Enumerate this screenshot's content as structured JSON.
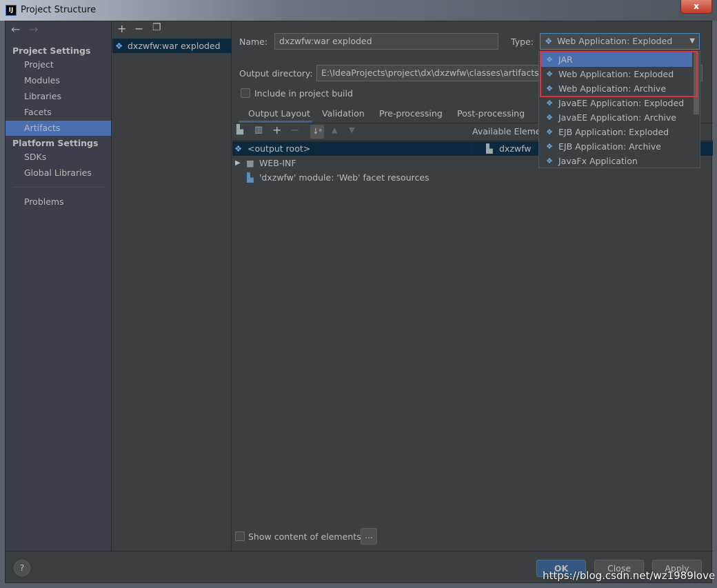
{
  "window": {
    "title": "Project Structure",
    "logo": "IJ",
    "close": "x"
  },
  "sidebar": {
    "project_settings": "Project Settings",
    "items": [
      {
        "label": "Project"
      },
      {
        "label": "Modules"
      },
      {
        "label": "Libraries"
      },
      {
        "label": "Facets"
      },
      {
        "label": "Artifacts",
        "selected": true
      }
    ],
    "platform_settings": "Platform Settings",
    "platform_items": [
      {
        "label": "SDKs"
      },
      {
        "label": "Global Libraries"
      }
    ],
    "problems": "Problems"
  },
  "artifacts": {
    "items": [
      {
        "label": "dxzwfw:war exploded"
      }
    ]
  },
  "form": {
    "name_label": "Name:",
    "name_value": "dxzwfw:war exploded",
    "type_label": "Type:",
    "type_value": "Web Application: Exploded",
    "output_label": "Output directory:",
    "output_value": "E:\\IdeaProjects\\project\\dx\\dxzwfw\\classes\\artifacts\\dx",
    "include_label": "Include in project build",
    "include_checked": false
  },
  "tabs": [
    {
      "label": "Output Layout",
      "active": true
    },
    {
      "label": "Validation"
    },
    {
      "label": "Pre-processing"
    },
    {
      "label": "Post-processing"
    }
  ],
  "layout": {
    "available_label": "Available Elemer",
    "tree": [
      {
        "label": "<output root>",
        "selected": true
      },
      {
        "label": "WEB-INF"
      },
      {
        "label": "'dxzwfw' module: 'Web' facet resources"
      }
    ],
    "available": [
      {
        "label": "dxzwfw"
      }
    ],
    "show_content_label": "Show content of elements",
    "more_button": "..."
  },
  "dropdown": {
    "options": [
      {
        "label": "JAR",
        "selected": true
      },
      {
        "label": "Web Application: Exploded"
      },
      {
        "label": "Web Application: Archive"
      },
      {
        "label": "JavaEE Application: Exploded"
      },
      {
        "label": "JavaEE Application: Archive"
      },
      {
        "label": "EJB Application: Exploded"
      },
      {
        "label": "EJB Application: Archive"
      },
      {
        "label": "JavaFx Application"
      }
    ]
  },
  "buttons": {
    "help": "?",
    "ok": "OK",
    "close": "Close",
    "apply": "Apply"
  },
  "watermark": "https://blog.csdn.net/wz1989love",
  "colors": {
    "accent": "#4b6eaf",
    "highlight_box": "#e8303a",
    "selection_dark": "#0d293e"
  }
}
